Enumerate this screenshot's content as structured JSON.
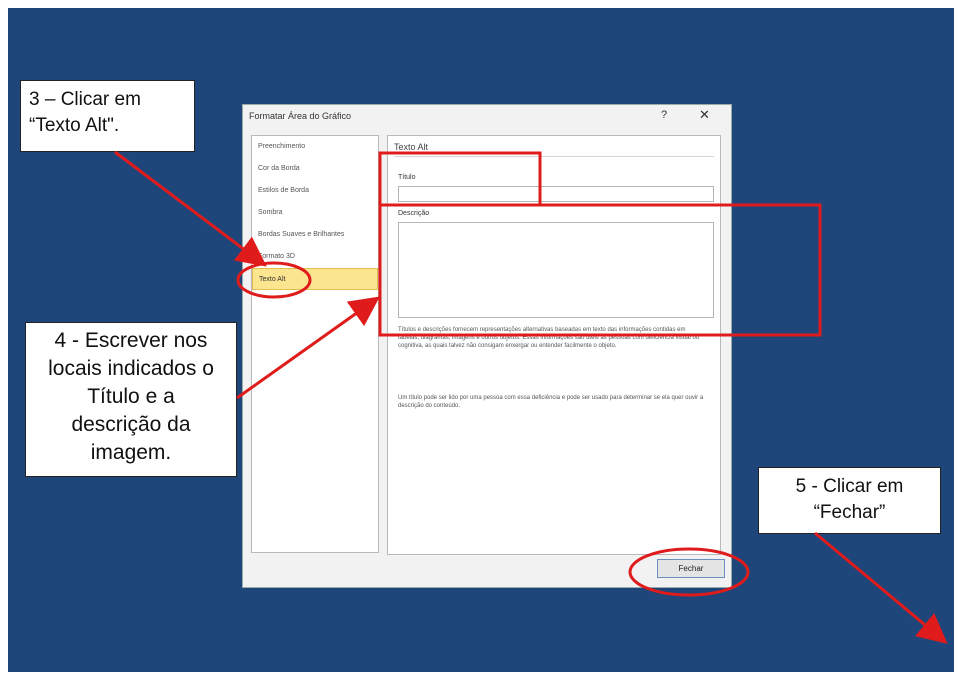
{
  "callouts": {
    "step3": [
      "3 – Clicar em",
      "“Texto Alt\"."
    ],
    "step4": [
      "4 - Escrever nos",
      "locais indicados o",
      "Título e a",
      "descrição da",
      "imagem."
    ],
    "step5": [
      "5 - Clicar em",
      "“Fechar”"
    ]
  },
  "dialog": {
    "title": "Formatar Área do Gráfico",
    "help_glyph": "?",
    "close_glyph": "✕",
    "sidebar": [
      "Preenchimento",
      "Cor da Borda",
      "Estilos de Borda",
      "Sombra",
      "Bordas Suaves e Brilhantes",
      "Formato 3D",
      "Texto Alt"
    ],
    "content": {
      "heading": "Texto Alt",
      "title_label": "Título",
      "description_label": "Descrição",
      "help_text_1": "Títulos e descrições fornecem representações alternativas baseadas em texto das informações contidas em tabelas, diagramas, imagens e outros objetos. Essas informações são úteis às pessoas com deficiência visual ou cognitiva, as quais talvez não consigam enxergar ou entender facilmente o objeto.",
      "help_text_2": "Um título pode ser lido por uma pessoa com essa deficiência e pode ser usado para determinar se ela quer ouvir a descrição do conteúdo."
    },
    "close_button": "Fechar"
  },
  "colors": {
    "background": "#1f467b",
    "annotation": "#e01b1b",
    "selected_item": "#fce58f"
  }
}
